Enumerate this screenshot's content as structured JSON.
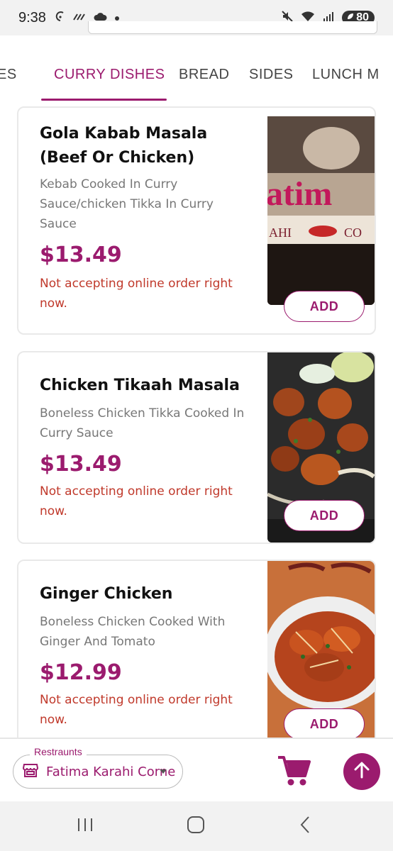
{
  "status_bar": {
    "time": "9:38",
    "battery": "80"
  },
  "tabs": [
    {
      "label": "ES",
      "active": false
    },
    {
      "label": "CURRY DISHES",
      "active": true
    },
    {
      "label": "BREAD",
      "active": false
    },
    {
      "label": "SIDES",
      "active": false
    },
    {
      "label": "LUNCH M",
      "active": false
    }
  ],
  "menu_items": [
    {
      "title": "Gola Kabab Masala (Beef Or Chicken)",
      "description": "Kebab Cooked In Curry Sauce/chicken Tikka In Curry Sauce",
      "price": "$13.49",
      "note": "Not accepting online order right now.",
      "add_label": "ADD",
      "image": "restaurant-logo-photo"
    },
    {
      "title": "Chicken Tikaah Masala",
      "description": "Boneless Chicken Tikka Cooked In Curry Sauce",
      "price": "$13.49",
      "note": "Not accepting online order right now.",
      "add_label": "ADD",
      "image": "chicken-tikka-photo"
    },
    {
      "title": "Ginger Chicken",
      "description": "Boneless Chicken Cooked With Ginger And Tomato",
      "price": "$12.99",
      "note": "Not accepting online order right now.",
      "add_label": "ADD",
      "image": "ginger-chicken-photo"
    }
  ],
  "bottom_bar": {
    "restaurant_label": "Restraunts",
    "restaurant_value": "Fatima Karahi Corne"
  },
  "colors": {
    "accent": "#9b1b6e",
    "warning": "#c0392b",
    "muted_text": "#777777"
  }
}
